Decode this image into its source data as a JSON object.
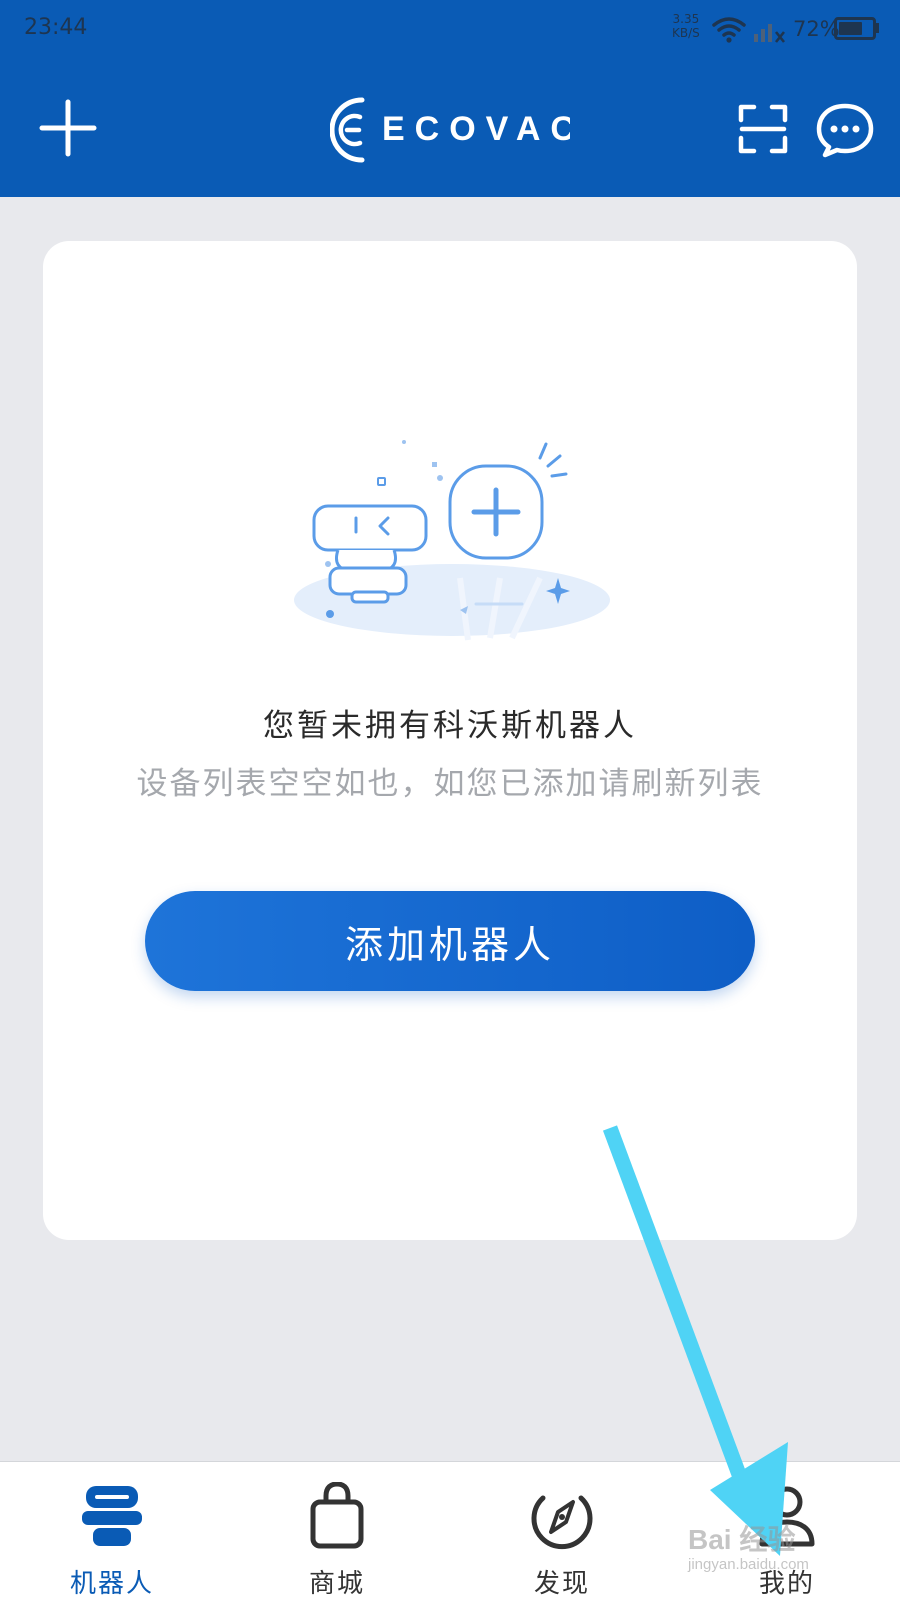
{
  "status_bar": {
    "time": "23:44",
    "net_speed_value": "3.35",
    "net_speed_unit": "KB/S",
    "battery": "72%",
    "battery_level": 0.72
  },
  "header": {
    "brand": "ECOVACS",
    "add_icon": "plus-icon",
    "scan_icon": "scan-icon",
    "message_icon": "chat-bubble-icon"
  },
  "empty_state": {
    "title": "您暂未拥有科沃斯机器人",
    "subtitle": "设备列表空空如也，如您已添加请刷新列表",
    "button_label": "添加机器人"
  },
  "tabs": [
    {
      "label": "机器人",
      "icon": "robot-icon",
      "active": true
    },
    {
      "label": "商城",
      "icon": "shopping-bag-icon",
      "active": false
    },
    {
      "label": "发现",
      "icon": "compass-icon",
      "active": false
    },
    {
      "label": "我的",
      "icon": "profile-icon",
      "active": false
    }
  ],
  "watermark": {
    "main": "Bai 经验",
    "sub": "jingyan.baidu.com"
  },
  "colors": {
    "brand_blue": "#0a5bb5",
    "button_blue": "#1e74d9",
    "annotation_arrow": "#4fd3f5"
  }
}
